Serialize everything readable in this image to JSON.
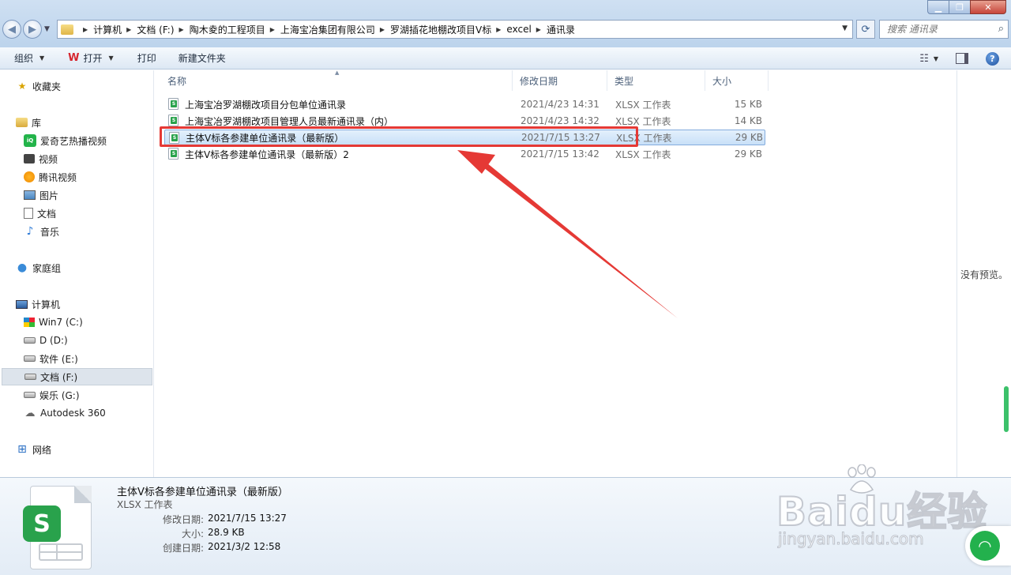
{
  "address": {
    "breadcrumbs": [
      "计算机",
      "文档 (F:)",
      "陶木夌的工程项目",
      "上海宝冶集团有限公司",
      "罗湖插花地棚改项目V标",
      "excel",
      "通讯录"
    ]
  },
  "search": {
    "placeholder": "搜索 通讯录"
  },
  "toolbar": {
    "organize": "组织",
    "open": "打开",
    "print": "打印",
    "new_folder": "新建文件夹"
  },
  "nav": {
    "favorites": "收藏夹",
    "libraries": "库",
    "lib_items": [
      "爱奇艺热播视频",
      "视频",
      "腾讯视频",
      "图片",
      "文档",
      "音乐"
    ],
    "homegroup": "家庭组",
    "computer": "计算机",
    "drives": [
      "Win7 (C:)",
      "D (D:)",
      "软件 (E:)",
      "文档 (F:)",
      "娱乐 (G:)",
      "Autodesk 360"
    ],
    "network": "网络"
  },
  "columns": {
    "name": "名称",
    "modified": "修改日期",
    "type": "类型",
    "size": "大小"
  },
  "files": [
    {
      "name": "上海宝冶罗湖棚改项目分包单位通讯录",
      "modified": "2021/4/23 14:31",
      "type": "XLSX 工作表",
      "size": "15 KB"
    },
    {
      "name": "上海宝冶罗湖棚改项目管理人员最新通讯录（内）",
      "modified": "2021/4/23 14:32",
      "type": "XLSX 工作表",
      "size": "14 KB"
    },
    {
      "name": "主体V标各参建单位通讯录（最新版）",
      "modified": "2021/7/15 13:27",
      "type": "XLSX 工作表",
      "size": "29 KB"
    },
    {
      "name": "主体V标各参建单位通讯录（最新版）2",
      "modified": "2021/7/15 13:42",
      "type": "XLSX 工作表",
      "size": "29 KB"
    }
  ],
  "preview": {
    "message": "没有预览。"
  },
  "details": {
    "title": "主体V标各参建单位通讯录（最新版）",
    "type": "XLSX 工作表",
    "modified_label": "修改日期:",
    "modified_value": "2021/7/15 13:27",
    "size_label": "大小:",
    "size_value": "28.9 KB",
    "created_label": "创建日期:",
    "created_value": "2021/3/2 12:58",
    "icon_letter": "S"
  },
  "watermark": {
    "brand": "Baidu经验",
    "url": "jingyan.baidu.com"
  },
  "colors": {
    "accent_red": "#e53935",
    "wps_green": "#29a24c",
    "selection": "#c8e0f8"
  }
}
